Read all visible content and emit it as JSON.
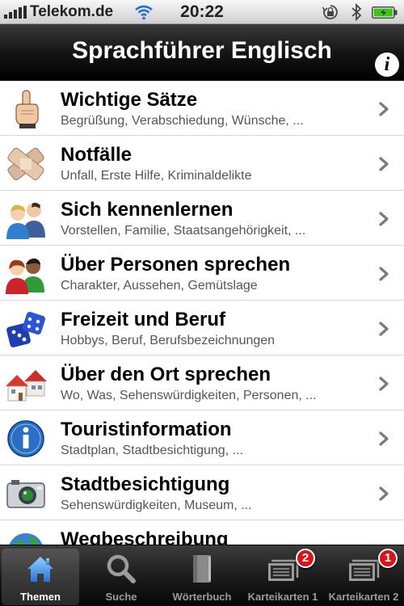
{
  "status_bar": {
    "carrier": "Telekom.de",
    "time": "20:22"
  },
  "nav": {
    "title": "Sprachführer Englisch",
    "info_glyph": "i"
  },
  "list": {
    "items": [
      {
        "title": "Wichtige Sätze",
        "subtitle": "Begrüßung, Verabschiedung, Wünsche, ...",
        "icon": "pointing-finger-icon"
      },
      {
        "title": "Notfälle",
        "subtitle": "Unfall, Erste Hilfe, Kriminaldelikte",
        "icon": "bandage-icon"
      },
      {
        "title": "Sich kennenlernen",
        "subtitle": "Vorstellen, Familie, Staatsangehörigkeit, ...",
        "icon": "people-icon"
      },
      {
        "title": "Über Personen sprechen",
        "subtitle": "Charakter, Aussehen, Gemütslage",
        "icon": "persons-icon"
      },
      {
        "title": "Freizeit und Beruf",
        "subtitle": "Hobbys, Beruf, Berufsbezeichnungen",
        "icon": "dice-icon"
      },
      {
        "title": "Über den Ort sprechen",
        "subtitle": "Wo, Was, Sehenswürdigkeiten, Personen, ...",
        "icon": "houses-icon"
      },
      {
        "title": "Touristinformation",
        "subtitle": "Stadtplan, Stadtbesichtigung, ...",
        "icon": "info-icon"
      },
      {
        "title": "Stadtbesichtigung",
        "subtitle": "Sehenswürdigkeiten, Museum, ...",
        "icon": "camera-icon"
      },
      {
        "title": "Wegbeschreibung",
        "subtitle": "",
        "icon": "globe-icon"
      }
    ]
  },
  "tabs": [
    {
      "label": "Themen",
      "icon": "home-icon",
      "active": true
    },
    {
      "label": "Suche",
      "icon": "search-icon"
    },
    {
      "label": "Wörterbuch",
      "icon": "book-icon"
    },
    {
      "label": "Karteikarten 1",
      "icon": "flashcards-icon",
      "badge": "2"
    },
    {
      "label": "Karteikarten 2",
      "icon": "flashcards-icon",
      "badge": "1"
    }
  ],
  "colors": {
    "badge": "#d8141b",
    "battery": "#3fc21b",
    "tab_icon_active": "#3e8ee0"
  }
}
